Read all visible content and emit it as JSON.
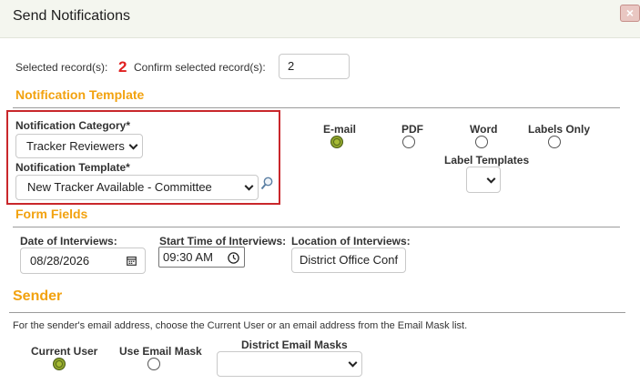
{
  "dialog": {
    "title": "Send Notifications",
    "close_label": "×"
  },
  "selection": {
    "selected_label": "Selected record(s):",
    "selected_count": "2",
    "confirm_label": "Confirm selected record(s):",
    "confirm_value": "2"
  },
  "notification_template": {
    "heading": "Notification Template",
    "category_label": "Notification Category*",
    "category_value": "Tracker Reviewers",
    "template_label": "Notification Template*",
    "template_value": "New Tracker Available - Committee",
    "formats": [
      {
        "label": "E-mail",
        "selected": true
      },
      {
        "label": "PDF",
        "selected": false
      },
      {
        "label": "Word",
        "selected": false
      },
      {
        "label": "Labels Only",
        "selected": false
      }
    ],
    "label_templates_label": "Label Templates",
    "label_templates_value": ""
  },
  "form_fields": {
    "heading": "Form Fields",
    "date_label": "Date of Interviews:",
    "date_value": "08/28/2026",
    "time_label": "Start Time of Interviews:",
    "time_value": "09:30 AM",
    "location_label": "Location of Interviews:",
    "location_value": "District Office Conf"
  },
  "sender": {
    "heading": "Sender",
    "note": "For the sender's email address, choose the Current User or an email address from the Email Mask list.",
    "options": [
      {
        "label": "Current User",
        "selected": true
      },
      {
        "label": "Use Email Mask",
        "selected": false
      }
    ],
    "masks_label": "District Email Masks",
    "masks_value": ""
  },
  "colors": {
    "section_heading": "#f2a20f",
    "highlight_border": "#c9272b",
    "count_text": "#e02020",
    "radio_selected": "#8ea32b"
  }
}
